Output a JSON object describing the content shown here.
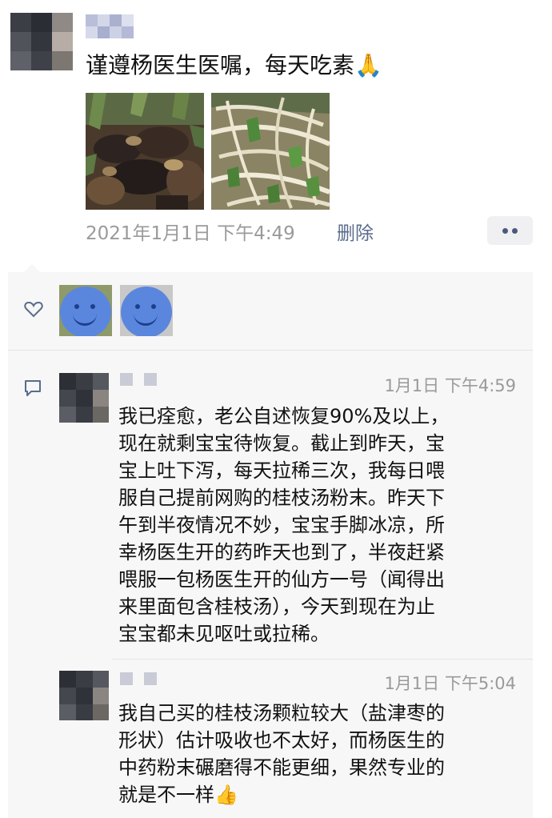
{
  "post": {
    "text": "谨遵杨医生医嘱，每天吃素🙏",
    "date": "2021年1月1日 下午4:49",
    "delete_label": "删除"
  },
  "icons": {
    "like": "heart-icon",
    "comment": "comment-icon",
    "more": "more-dots-icon"
  },
  "comments": [
    {
      "time": "1月1日 下午4:59",
      "lines": [
        "我已痊愈，老公自述恢复90%及以上，",
        "现在就剩宝宝待恢复。截止到昨天，宝",
        "宝上吐下泻，每天拉稀三次，我每日喂",
        "服自己提前网购的桂枝汤粉末。昨天下",
        "午到半夜情况不妙，宝宝手脚冰凉，所",
        "幸杨医生开的药昨天也到了，半夜赶紧",
        "喂服一包杨医生开的仙方一号（闻得出",
        "来里面包含桂枝汤），今天到现在为止",
        "宝宝都未见呕吐或拉稀。"
      ]
    },
    {
      "time": "1月1日 下午5:04",
      "lines": [
        "我自己买的桂枝汤颗粒较大（盐津枣的",
        "形状）估计吸收也不太好，而杨医生的",
        "中药粉末碾磨得不能更细，果然专业的",
        "就是不一样👍"
      ]
    }
  ],
  "colors": {
    "link": "#5a6c8c",
    "meta": "#9a9a9a",
    "panel": "#f7f7f7"
  }
}
